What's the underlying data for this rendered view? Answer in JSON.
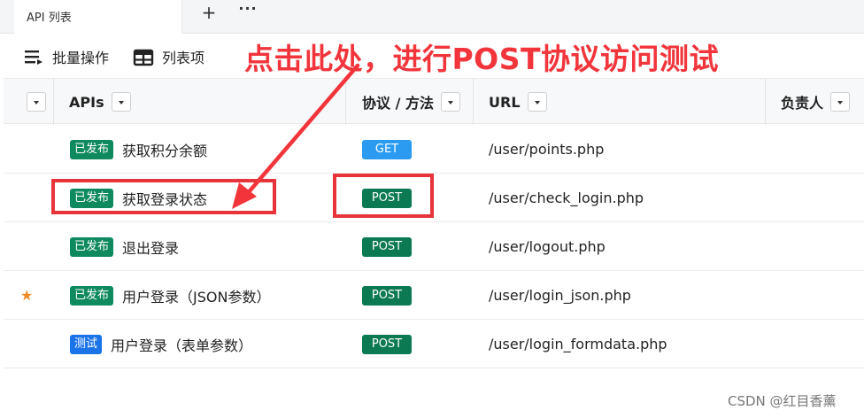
{
  "tabs": {
    "active_tab_label": "API 列表",
    "plus_label": "+",
    "more_label": "···"
  },
  "toolbar": {
    "batch_label": "批量操作",
    "columns_label": "列表项"
  },
  "annotation": {
    "text": "点击此处，进行POST协议访问测试",
    "color": "#f2343b"
  },
  "table": {
    "headers": {
      "apis": "APIs",
      "method": "协议 / 方法",
      "url": "URL",
      "owner": "负责人"
    },
    "rows": [
      {
        "starred": false,
        "status": "已发布",
        "status_color": "#0f8a5f",
        "name": "获取积分余额",
        "method": "GET",
        "method_color": "#2a9bf0",
        "url": "/user/points.php"
      },
      {
        "starred": false,
        "status": "已发布",
        "status_color": "#0f8a5f",
        "name": "获取登录状态",
        "method": "POST",
        "method_color": "#0b7a52",
        "url": "/user/check_login.php"
      },
      {
        "starred": false,
        "status": "已发布",
        "status_color": "#0f8a5f",
        "name": "退出登录",
        "method": "POST",
        "method_color": "#0b7a52",
        "url": "/user/logout.php"
      },
      {
        "starred": true,
        "status": "已发布",
        "status_color": "#0f8a5f",
        "name": "用户登录（JSON参数）",
        "method": "POST",
        "method_color": "#0b7a52",
        "url": "/user/login_json.php"
      },
      {
        "starred": false,
        "status": "测试",
        "status_color": "#1a73e8",
        "name": "用户登录（表单参数）",
        "method": "POST",
        "method_color": "#0b7a52",
        "url": "/user/login_formdata.php"
      }
    ]
  },
  "icons": {
    "star": "star-icon",
    "batch": "list-ops-icon",
    "columns": "table-columns-icon"
  },
  "star_glyph": "★",
  "watermark": "CSDN @红目香薰"
}
